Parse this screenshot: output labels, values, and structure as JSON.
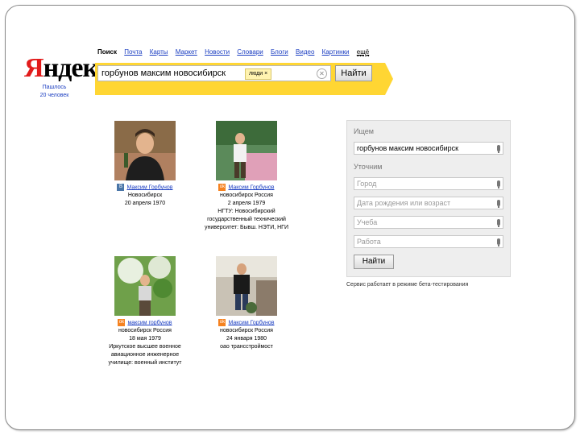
{
  "nav": {
    "items": [
      "Поиск",
      "Почта",
      "Карты",
      "Маркет",
      "Новости",
      "Словари",
      "Блоги",
      "Видео",
      "Картинки",
      "ещё"
    ],
    "active_index": 0
  },
  "logo": {
    "first_letter": "Я",
    "rest": "ндекс",
    "subtitle_line1": "Пашлось",
    "subtitle_line2": "20 человек"
  },
  "search": {
    "query": "горбунов максим новосибирск",
    "tag": "люди ×",
    "button": "Найти"
  },
  "results": [
    {
      "service": "vk",
      "icon_text": "B",
      "name": "Максим Горбунов",
      "lines": [
        "Новосибирск",
        "20 апреля 1970"
      ]
    },
    {
      "service": "ok",
      "icon_text": "ok",
      "name": "Максим Горбунов",
      "lines": [
        "новосибирск Россия",
        "2 апреля 1979",
        "НГТУ: Новосибирский",
        "государственный технический",
        "университет: Бывш. НЭТИ, НГИ"
      ]
    },
    {
      "service": "ok",
      "icon_text": "ok",
      "name": "максим горбунов",
      "lines": [
        "новосибирск Россия",
        "18 мая 1979",
        "Иркутское высшее военное",
        "авиационное инженерное",
        "училище: военный институт"
      ]
    },
    {
      "service": "ok",
      "icon_text": "ok",
      "name": "Максим Горбунов",
      "lines": [
        "новосибирск Россия",
        "24 января 1980",
        "оао трансстроймост"
      ]
    }
  ],
  "panel": {
    "looking_label": "Ищем",
    "query_value": "горбунов максим новосибирск",
    "refine_label": "Уточним",
    "city_placeholder": "Город",
    "birth_placeholder": "Дата рождения или возраст",
    "study_placeholder": "Учеба",
    "work_placeholder": "Работа",
    "button": "Найти"
  },
  "beta_note": "Сервис работает в режиме бета-тестирования",
  "colors": {
    "accent_yellow": "#ffd633",
    "link_blue": "#1a3dc1",
    "logo_red": "#e21b1b"
  }
}
